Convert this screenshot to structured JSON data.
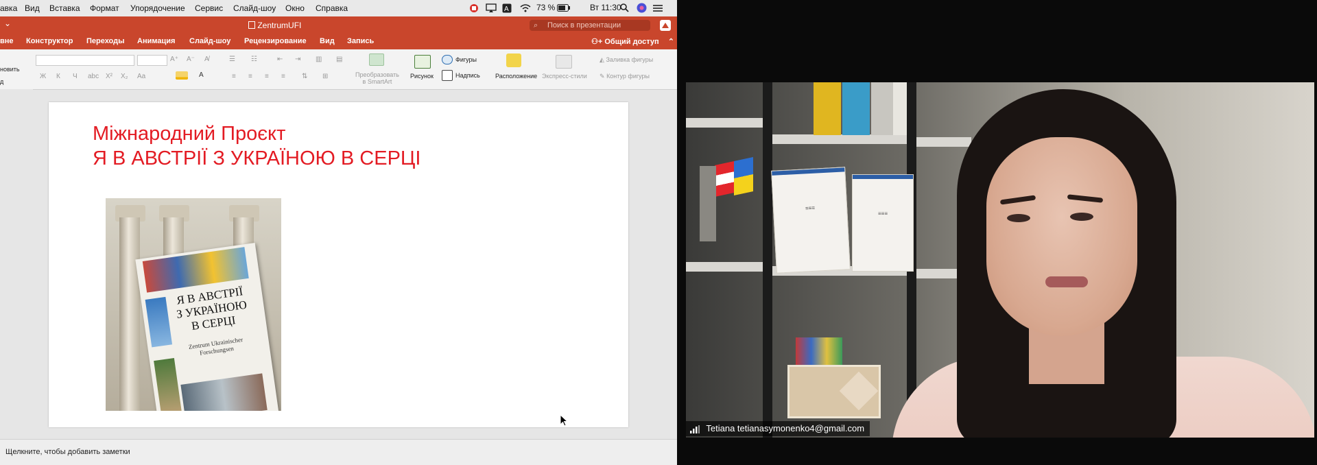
{
  "mac_menu": [
    "авка",
    "Вид",
    "Вставка",
    "Формат",
    "Упорядочение",
    "Сервис",
    "Слайд-шоу",
    "Окно",
    "Справка"
  ],
  "mac_status": {
    "battery": "73 %",
    "time": "Вт 11:30"
  },
  "window": {
    "document_title": "ZentrumUFI",
    "search_placeholder": "Поиск в презентации"
  },
  "ribbon_tabs": [
    "вне",
    "Конструктор",
    "Переходы",
    "Анимация",
    "Слайд-шоу",
    "Рецензирование",
    "Вид",
    "Запись"
  ],
  "share_label": "Общий доступ",
  "ribbon": {
    "left_stub": [
      "новить",
      "д"
    ],
    "format_buttons": [
      "Ж",
      "К",
      "Ч",
      "abc",
      "X²",
      "X₂",
      "Aa"
    ],
    "smartart_label": "Преобразовать\nв SmartArt",
    "picture_label": "Рисунок",
    "shapes_label": "Фигуры",
    "textbox_label": "Надпись",
    "arrange_label": "Расположение",
    "quick_styles_label": "Экспресс-стили",
    "shape_fill_label": "Заливка фигуры",
    "shape_outline_label": "Контур фигуры"
  },
  "slide": {
    "title_line1": "Міжнародний Проєкт",
    "title_line2": "Я В АВСТРІЇ З УКРАЇНОЮ В СЕРЦІ",
    "book_title": "Я В АВСТРІЇ\nЗ УКРАЇНОЮ\nВ СЕРЦІ",
    "book_subtitle": "Zentrum Ukrainischer\nForschungsen"
  },
  "notes_placeholder": "Щелкните, чтобы добавить заметки",
  "video": {
    "participant_label": "Tetiana tetianasymonenko4@gmail.com"
  },
  "colors": {
    "ppt_accent": "#c9462c",
    "slide_title": "#e31b23"
  }
}
